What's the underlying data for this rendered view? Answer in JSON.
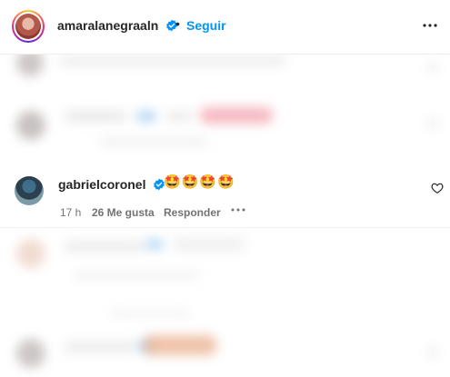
{
  "header": {
    "username": "amaralanegraaln",
    "separator": "•",
    "follow_label": "Seguir"
  },
  "comment": {
    "username": "gabrielcoronel",
    "text": "🤩🤩🤩🤩",
    "time": "17 h",
    "likes": "26 Me gusta",
    "reply_label": "Responder"
  },
  "icons": {
    "verified": "verified-badge-icon",
    "more": "more-options-icon",
    "like": "heart-icon"
  },
  "colors": {
    "accent": "#0095f6",
    "text": "#262626",
    "secondary": "#737373"
  }
}
